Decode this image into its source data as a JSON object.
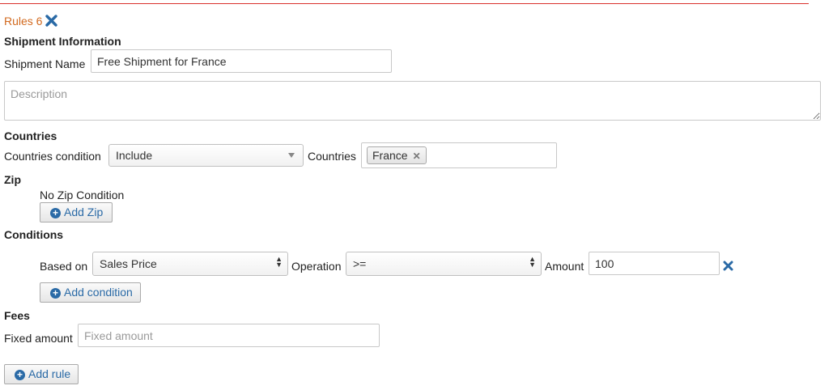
{
  "header": {
    "title": "Rules 6"
  },
  "shipment": {
    "section_label": "Shipment Information",
    "name_label": "Shipment Name",
    "name_value": "Free Shipment for France",
    "description_placeholder": "Description"
  },
  "countries": {
    "section_label": "Countries",
    "condition_label": "Countries condition",
    "condition_value": "Include",
    "countries_label": "Countries",
    "selected": [
      "France"
    ]
  },
  "zip": {
    "section_label": "Zip",
    "status": "No Zip Condition",
    "add_button": "Add Zip"
  },
  "conditions": {
    "section_label": "Conditions",
    "rows": [
      {
        "based_on_label": "Based on",
        "based_on_value": "Sales Price",
        "operation_label": "Operation",
        "operation_value": ">=",
        "amount_label": "Amount",
        "amount_value": "100"
      }
    ],
    "add_button": "Add condition"
  },
  "fees": {
    "section_label": "Fees",
    "fixed_label": "Fixed amount",
    "fixed_placeholder": "Fixed amount"
  },
  "footer": {
    "add_rule_button": "Add rule"
  },
  "colors": {
    "accent": "#2a6aa6",
    "title": "#d2691e",
    "rule_line": "#d9312c"
  },
  "icons": {
    "remove": "close-icon",
    "add": "plus-circle-icon",
    "dropdown": "chevron-down-icon"
  }
}
